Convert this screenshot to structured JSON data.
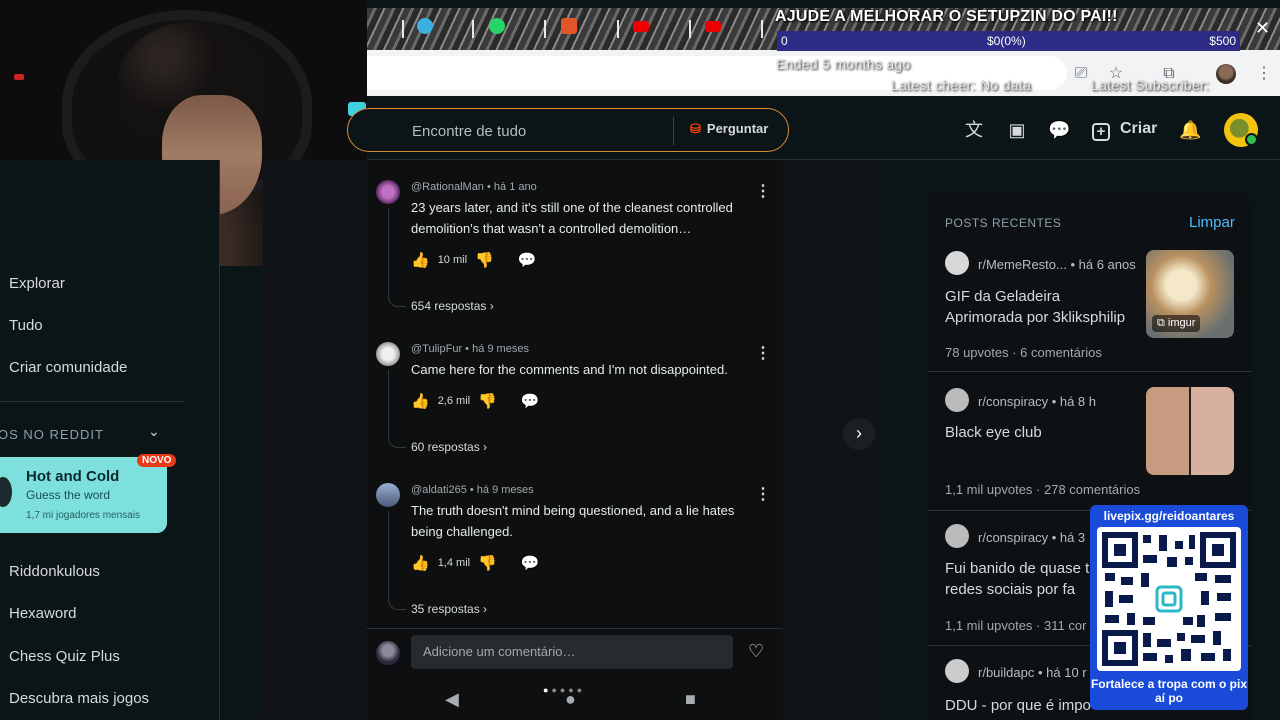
{
  "overlay": {
    "title": "AJUDE A MELHORAR O SETUPZIN DO PAI!!",
    "goal_start": "0",
    "goal_progress": "$0(0%)",
    "goal_target": "$500",
    "goal_fraction": 0,
    "ended": "Ended 5 months ago",
    "latest_cheer": "Latest cheer: No data",
    "latest_subscriber": "Latest Subscriber:",
    "bar_color": "#2c2c86"
  },
  "header": {
    "search_placeholder": "Encontre de tudo",
    "ask_label": "Perguntar",
    "create_label": "Criar"
  },
  "sidebar": {
    "items": [
      "Explorar",
      "Tudo",
      "Criar comunidade"
    ],
    "section_title": "OS NO REDDIT",
    "game": {
      "title": "Hot and Cold",
      "subtitle": "Guess the word",
      "players": "1,7 mi jogadores mensais",
      "badge": "NOVO"
    },
    "games": [
      "Riddonkulous",
      "Hexaword",
      "Chess Quiz Plus",
      "Descubra mais jogos"
    ]
  },
  "comments": [
    {
      "author": "@RationalMan",
      "time": "há 1 ano",
      "text": "23 years later, and it's still one of the cleanest controlled demolition's that wasn't a controlled demolition…",
      "likes": "10 mil",
      "replies": "654 respostas"
    },
    {
      "author": "@TulipFur",
      "time": "há 9 meses",
      "text": "Came here for the comments and I'm not disappointed.",
      "likes": "2,6 mil",
      "replies": "60 respostas"
    },
    {
      "author": "@aldati265",
      "time": "há 9 meses",
      "text": "The truth doesn't mind being questioned, and a lie hates being challenged.",
      "likes": "1,4 mil",
      "replies": "35 respostas"
    }
  ],
  "composer": {
    "placeholder": "Adicione um comentário…"
  },
  "recent": {
    "title": "POSTS RECENTES",
    "clear_label": "Limpar",
    "posts": [
      {
        "sub": "r/MemeResto...",
        "time": "há 6 anos",
        "title": "GIF da Geladeira Aprimorada por 3kliksphilip",
        "upvotes": "78 upvotes",
        "comments": "6 comentários",
        "tag": "imgur"
      },
      {
        "sub": "r/conspiracy",
        "time": "há 8 h",
        "title": "Black eye club",
        "upvotes": "1,1 mil upvotes",
        "comments": "278 comentários"
      },
      {
        "sub": "r/conspiracy",
        "time": "há 3",
        "title": "Fui banido de quase t as redes sociais por fa",
        "upvotes": "1,1 mil upvotes",
        "comments": "311 cor"
      },
      {
        "sub": "r/buildapc",
        "time": "há 10 r",
        "title": "DDU - por que é impo"
      }
    ]
  },
  "livepix": {
    "url": "livepix.gg/reidoantares",
    "message": "Fortalece a tropa com o pix aí po"
  }
}
